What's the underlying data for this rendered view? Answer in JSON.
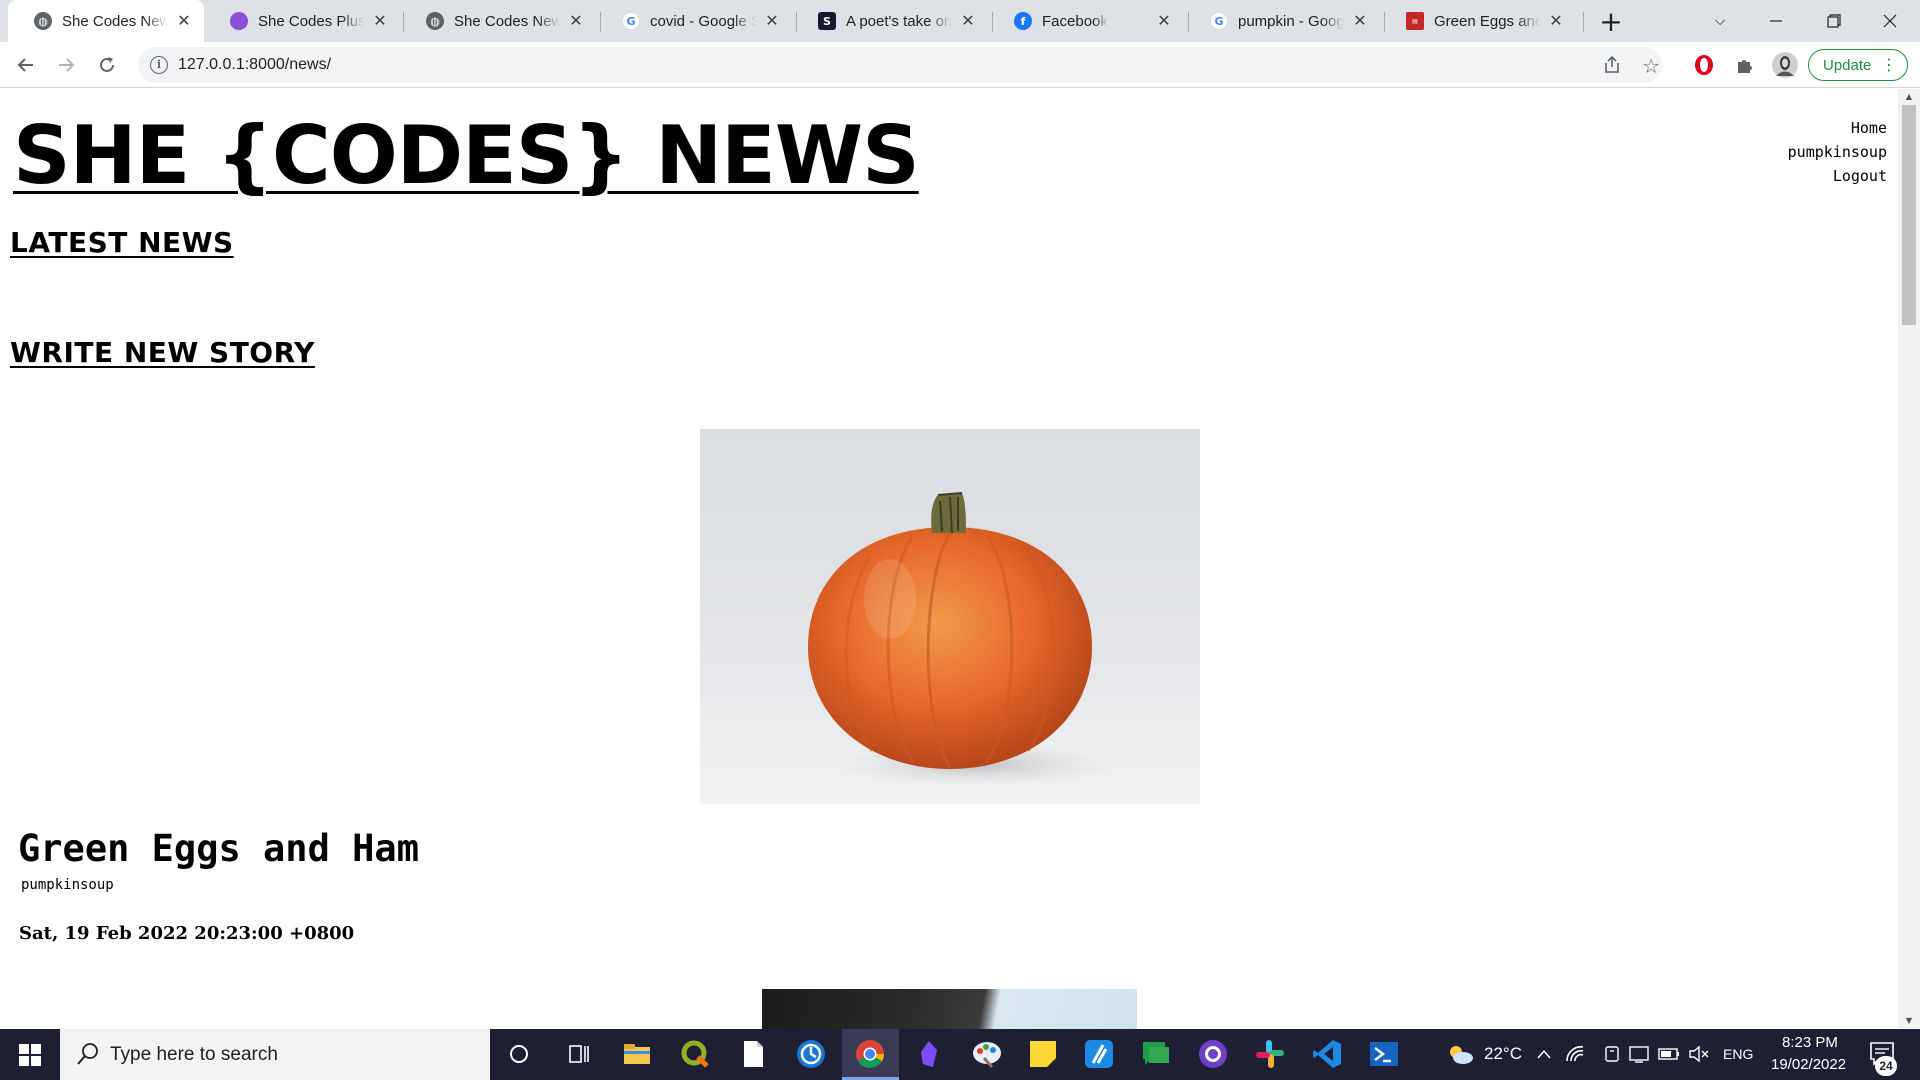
{
  "browser": {
    "tabs": [
      {
        "title": "She Codes News",
        "favicon": "globe-icon",
        "active": true
      },
      {
        "title": "She Codes Plus Pe",
        "favicon": "shecodes-icon",
        "active": false
      },
      {
        "title": "She Codes News",
        "favicon": "globe-icon",
        "active": false
      },
      {
        "title": "covid - Google Se",
        "favicon": "google-icon",
        "active": false
      },
      {
        "title": "A poet's take on t",
        "favicon": "substack-icon",
        "active": false
      },
      {
        "title": "Facebook",
        "favicon": "facebook-icon",
        "active": false
      },
      {
        "title": "pumpkin - Googl",
        "favicon": "google-icon",
        "active": false
      },
      {
        "title": "Green Eggs and H",
        "favicon": "bestpoems-icon",
        "active": false
      }
    ],
    "url": "127.0.0.1:8000/news/",
    "update_label": "Update"
  },
  "page": {
    "site_title": "SHE {CODES} NEWS",
    "nav": [
      "Home",
      "pumpkinsoup",
      "Logout"
    ],
    "latest_news": "LATEST NEWS",
    "write_new_story": "WRITE NEW STORY",
    "story": {
      "title": "Green Eggs and Ham",
      "author": "pumpkinsoup",
      "date": "Sat, 19 Feb 2022 20:23:00 +0800"
    }
  },
  "taskbar": {
    "search_placeholder": "Type here to search",
    "weather": "22°C",
    "language": "ENG",
    "time": "8:23 PM",
    "date": "19/02/2022",
    "notification_count": "24"
  },
  "colors": {
    "accent_green": "#1e8e3e",
    "tabstrip": "#dee1e6",
    "taskbar": "#1f1f33"
  }
}
